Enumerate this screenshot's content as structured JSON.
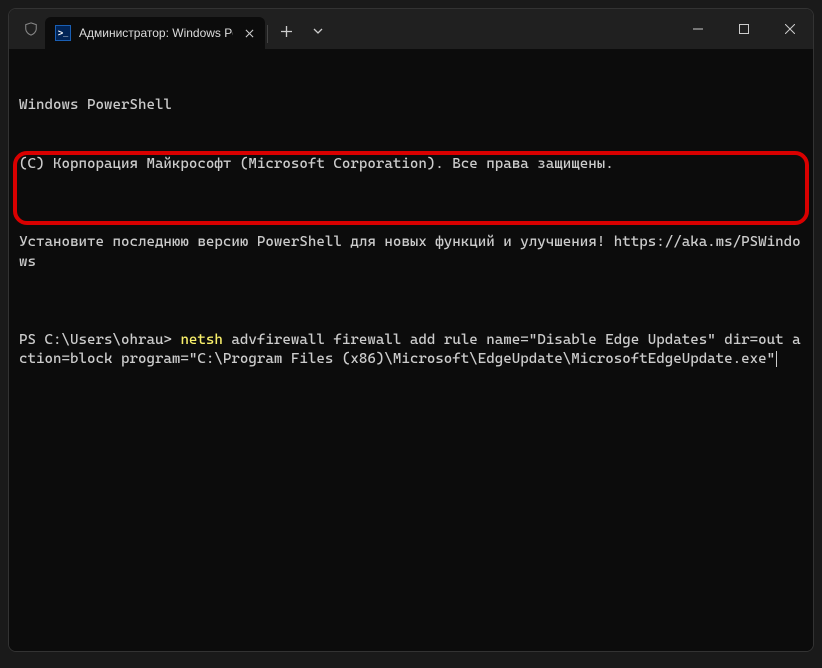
{
  "window": {
    "tab_title": "Администратор: Windows Po",
    "ps_icon_text": ">_"
  },
  "terminal": {
    "line1": "Windows PowerShell",
    "line2": "(C) Корпорация Майкрософт (Microsoft Corporation). Все права защищены.",
    "line3": "Установите последнюю версию PowerShell для новых функций и улучшения! https://aka.ms/PSWindows",
    "prompt": "PS C:\\Users\\ohrau> ",
    "cmd_highlight": "netsh",
    "cmd_rest": " advfirewall firewall add rule name=\"Disable Edge Updates\" dir=out action=block program=\"C:\\Program Files (x86)\\Microsoft\\EdgeUpdate\\MicrosoftEdgeUpdate.exe\""
  }
}
